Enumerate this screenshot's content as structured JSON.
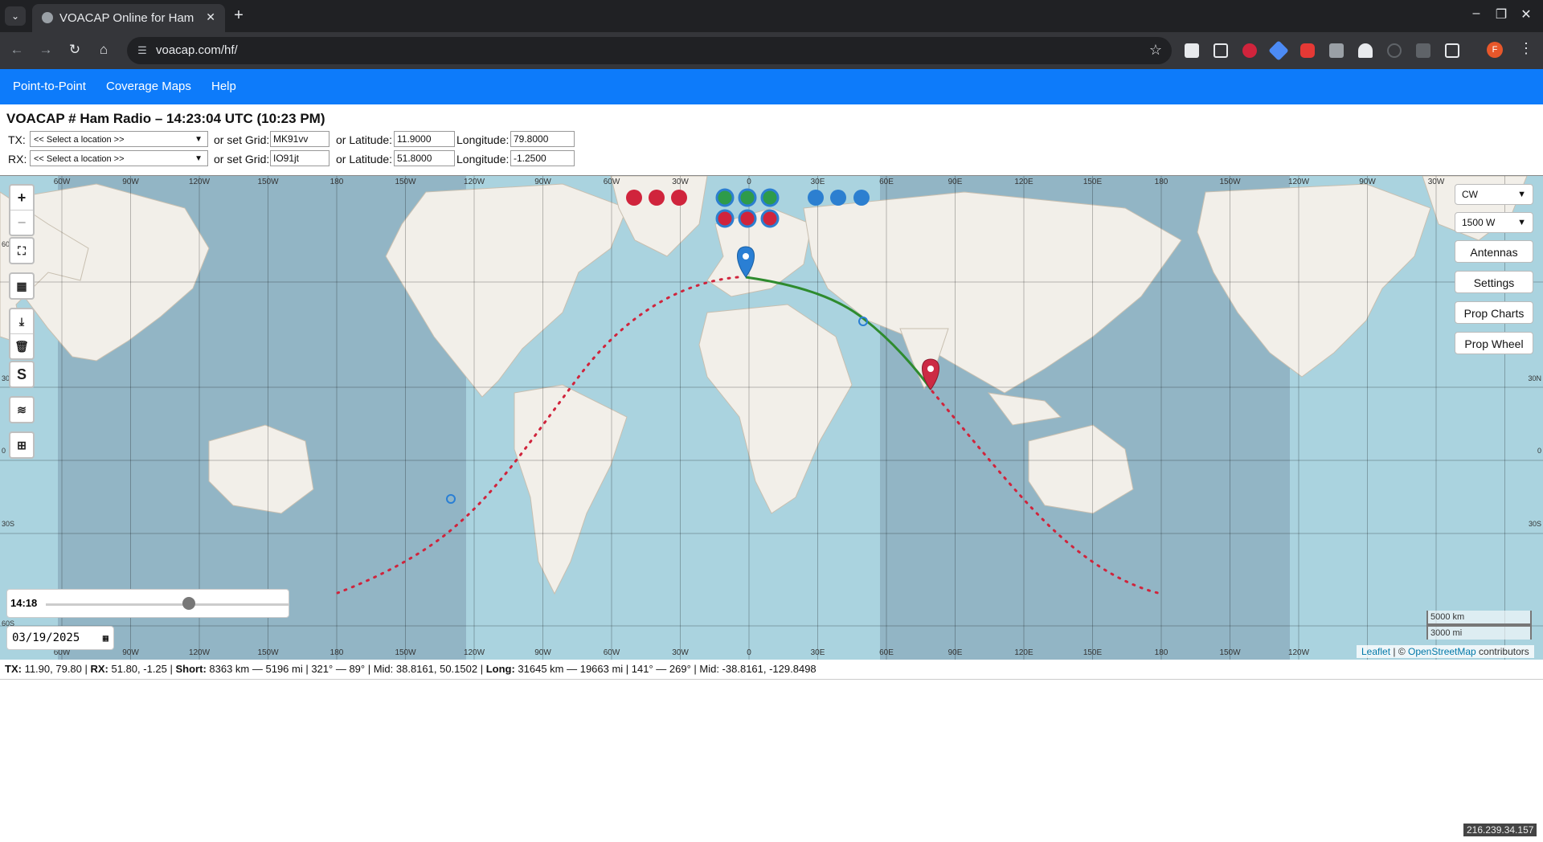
{
  "browser": {
    "tab_title": "VOACAP Online for Ham Radio",
    "url": "voacap.com/hf/",
    "profile_initial": "F"
  },
  "nav": {
    "items": [
      "Point-to-Point",
      "Coverage Maps",
      "Help"
    ]
  },
  "page_title": "VOACAP # Ham Radio – 14:23:04 UTC (10:23 PM)",
  "tx": {
    "label": "TX:",
    "location_placeholder": "<< Select a location >>",
    "grid_label": "or set Grid:",
    "grid": "MK91vv",
    "lat_label": "or Latitude:",
    "lat": "11.9000",
    "lon_label": "Longitude:",
    "lon": "79.8000"
  },
  "rx": {
    "label": "RX:",
    "location_placeholder": "<< Select a location >>",
    "grid_label": "or set Grid:",
    "grid": "IO91jt",
    "lat_label": "or Latitude:",
    "lat": "51.8000",
    "lon_label": "Longitude:",
    "lon": "-1.2500"
  },
  "map": {
    "top_lon_labels": [
      "60W",
      "90W",
      "120W",
      "150W",
      "180",
      "150W",
      "120W",
      "90W",
      "60W",
      "30W",
      "0",
      "30E",
      "60E",
      "90E",
      "120E",
      "150E",
      "180",
      "150W",
      "120W",
      "90W",
      "30W"
    ],
    "bottom_lon_labels": [
      "60W",
      "90W",
      "120W",
      "150W",
      "180",
      "150W",
      "120W",
      "90W",
      "60W",
      "30W",
      "0",
      "30E",
      "60E",
      "90E",
      "120E",
      "150E",
      "180",
      "150W",
      "120W"
    ],
    "left_lat_labels": [
      "60N",
      "30N",
      "0",
      "30S",
      "60S"
    ],
    "right_lat_labels": [
      "30N",
      "0",
      "30S"
    ],
    "mode": "CW",
    "power": "1500 W",
    "buttons": [
      "Antennas",
      "Settings",
      "Prop Charts",
      "Prop Wheel"
    ],
    "time_label": "14:18",
    "time_fraction": 0.59,
    "date": "03/19/2025",
    "scale_km": "5000 km",
    "scale_mi": "3000 mi",
    "attribution_leaflet": "Leaflet",
    "attribution_sep": " | © ",
    "attribution_osm": "OpenStreetMap",
    "attribution_tail": " contributors",
    "band_dots_row1": [
      "#d0243c",
      "#d0243c",
      "#d0243c",
      "#2e9b4a",
      "#2e9b4a",
      "#2e9b4a",
      "#2c7fd0",
      "#2c7fd0",
      "#2c7fd0"
    ],
    "band_dots_row2": [
      "#d0243c",
      "#d0243c",
      "#d0243c"
    ],
    "colors": {
      "short_path": "#2e8b2e",
      "long_path": "#d0243c",
      "tx_marker": "#2a7fd4",
      "rx_marker": "#cc2a44",
      "night": "rgba(0,0,40,0.14)"
    },
    "controls_left": [
      "zoom-in",
      "zoom-out",
      "fullscreen",
      "map-fold",
      "download",
      "trash",
      "S",
      "layers",
      "grid"
    ]
  },
  "status": {
    "tx_label": "TX:",
    "tx_val": " 11.90, 79.80 | ",
    "rx_label": "RX:",
    "rx_val": " 51.80, -1.25 | ",
    "short_label": "Short:",
    "short_val": " 8363 km — 5196 mi |  321° — 89° | Mid: 38.8161, 50.1502 | ",
    "long_label": "Long:",
    "long_val": " 31645 km — 19663 mi |  141° — 269° | Mid: -38.8161, -129.8498"
  },
  "ip": "216.239.34.157"
}
